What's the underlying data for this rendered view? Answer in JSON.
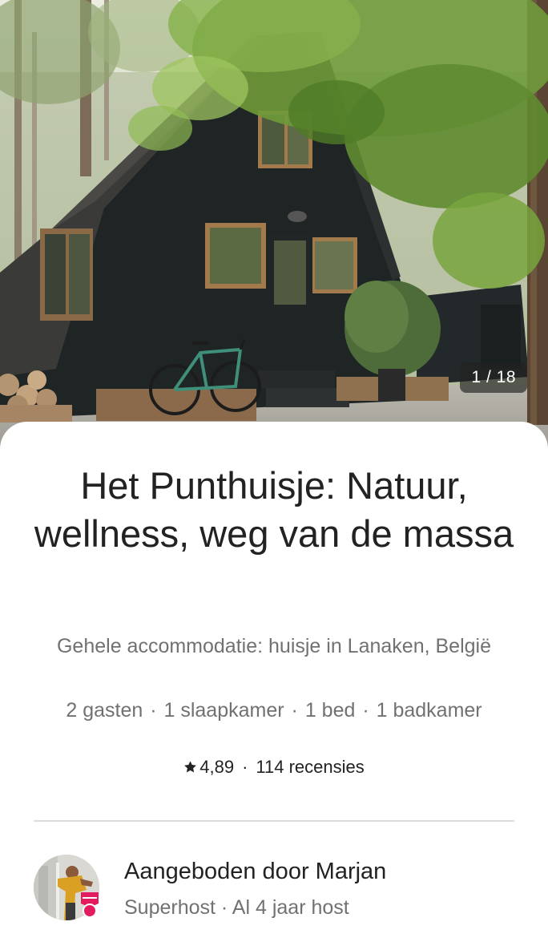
{
  "listing": {
    "title": "Het Punthuisje: Natuur, wellness, weg van de massa",
    "subtitle": "Gehele accommodatie: huisje in Lanaken, België",
    "photo_counter": "1 / 18",
    "details": [
      "2 gasten",
      "1 slaapkamer",
      "1 bed",
      "1 badkamer"
    ],
    "details_separator": "·"
  },
  "rating": {
    "icon": "star-icon",
    "score": "4,89",
    "separator": "·",
    "reviews": "114 recensies"
  },
  "host": {
    "name_line": "Aangeboden door Marjan",
    "meta": "Superhost · Al 4 jaar host",
    "badge_icon": "superhost-badge-icon",
    "badge_color": "#E31C5F"
  },
  "colors": {
    "text_primary": "#222222",
    "text_secondary": "#717171",
    "divider": "#DDDDDD",
    "counter_bg": "#222222"
  }
}
